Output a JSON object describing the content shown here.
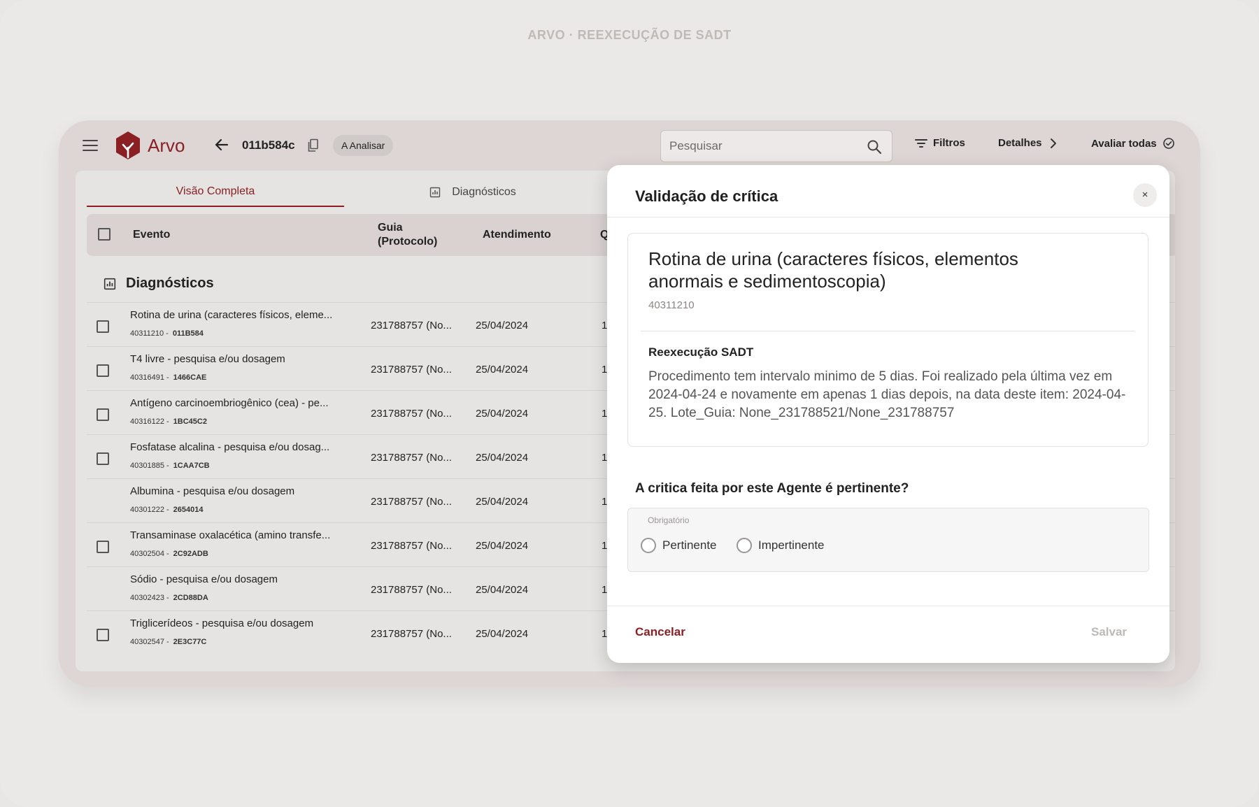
{
  "caption": "ARVO · REEXECUÇÃO DE SADT",
  "app": {
    "name": "Arvo",
    "brand_color": "#8a1f24"
  },
  "header": {
    "doc_id": "011b584c",
    "status_badge": "A Analisar",
    "search_placeholder": "Pesquisar",
    "filters_label": "Filtros",
    "details_label": "Detalhes",
    "evaluate_all_label": "Avaliar todas"
  },
  "tabs": [
    {
      "label": "Visão Completa",
      "active": true
    },
    {
      "label": "Diagnósticos",
      "active": false
    }
  ],
  "table": {
    "columns": [
      "Evento",
      "Guia\n(Protocolo)",
      "Atendimento",
      "Q"
    ],
    "section_title": "Diagnósticos",
    "rows": [
      {
        "name": "Rotina de urina (caracteres físicos, eleme...",
        "code": "40311210 -",
        "id": "011B584",
        "guia": "231788757 (No...",
        "data": "25/04/2024",
        "qtd": "1"
      },
      {
        "name": "T4 livre - pesquisa e/ou dosagem",
        "code": "40316491 -",
        "id": "1466CAE",
        "guia": "231788757 (No...",
        "data": "25/04/2024",
        "qtd": "1"
      },
      {
        "name": "Antígeno carcinoembriogênico (cea) - pe...",
        "code": "40316122 -",
        "id": "1BC45C2",
        "guia": "231788757 (No...",
        "data": "25/04/2024",
        "qtd": "1"
      },
      {
        "name": "Fosfatase alcalina - pesquisa e/ou dosag...",
        "code": "40301885 -",
        "id": "1CAA7CB",
        "guia": "231788757 (No...",
        "data": "25/04/2024",
        "qtd": "1"
      },
      {
        "name": "Albumina - pesquisa e/ou dosagem",
        "code": "40301222 -",
        "id": "2654014",
        "guia": "231788757 (No...",
        "data": "25/04/2024",
        "qtd": "1"
      },
      {
        "name": "Transaminase oxalacética (amino transfe...",
        "code": "40302504 -",
        "id": "2C92ADB",
        "guia": "231788757 (No...",
        "data": "25/04/2024",
        "qtd": "1"
      },
      {
        "name": "Sódio - pesquisa e/ou dosagem",
        "code": "40302423 -",
        "id": "2CD88DA",
        "guia": "231788757 (No...",
        "data": "25/04/2024",
        "qtd": "1"
      },
      {
        "name": "Triglicerídeos - pesquisa e/ou dosagem",
        "code": "40302547 -",
        "id": "2E3C77C",
        "guia": "231788757 (No...",
        "data": "25/04/2024",
        "qtd": "1"
      }
    ]
  },
  "modal": {
    "title": "Validação de crítica",
    "close_label": "×",
    "procedure_title": "Rotina de urina (caracteres físicos, elementos anormais e sedimentoscopia)",
    "procedure_code": "40311210",
    "rule_title": "Reexecução SADT",
    "rule_description": "Procedimento tem intervalo minimo de 5 dias. Foi realizado pela última vez em 2024-04-24 e novamente em apenas 1 dias depois, na data deste item: 2024-04-25. Lote_Guia: None_231788521/None_231788757",
    "question": "A critica feita por este Agente é pertinente?",
    "required_label": "Obrigatório",
    "option_pertinent": "Pertinente",
    "option_impertinent": "Impertinente",
    "cancel_label": "Cancelar",
    "save_label": "Salvar"
  }
}
